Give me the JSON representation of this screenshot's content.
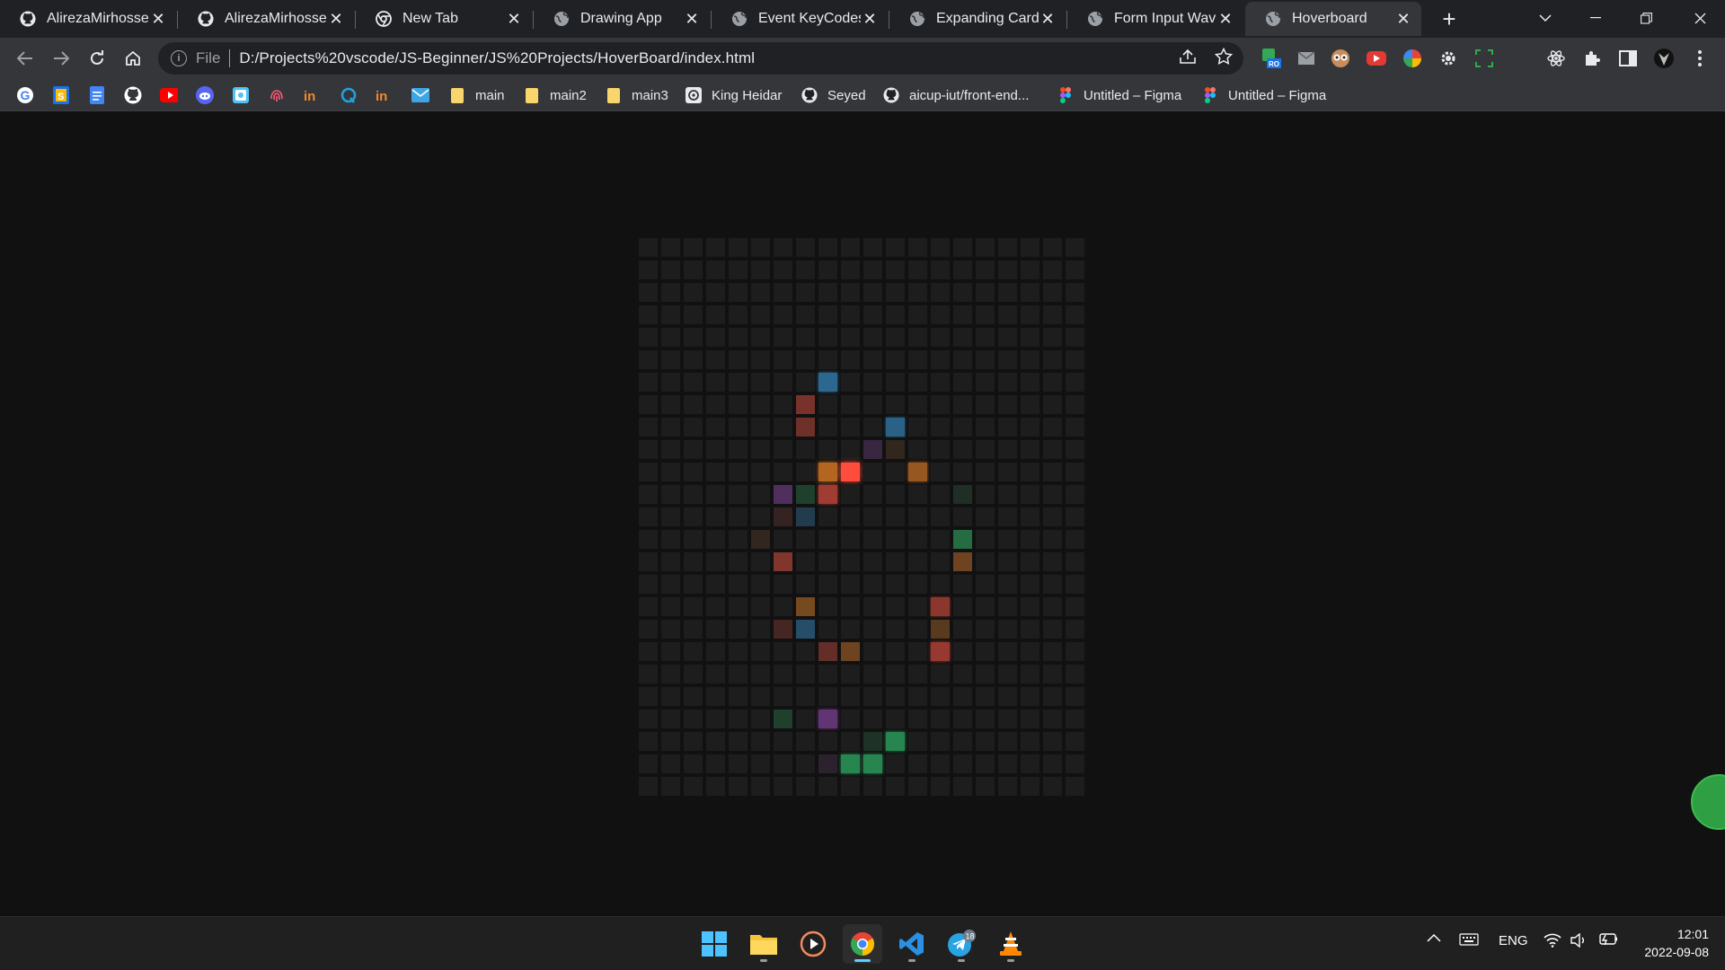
{
  "browser": {
    "tabs": [
      {
        "title": "AlirezaMirhossein",
        "icon": "github-icon",
        "active": false
      },
      {
        "title": "AlirezaMirhossein",
        "icon": "github-icon",
        "active": false
      },
      {
        "title": "New Tab",
        "icon": "chrome-icon",
        "active": false
      },
      {
        "title": "Drawing App",
        "icon": "globe-icon",
        "active": false
      },
      {
        "title": "Event KeyCodes",
        "icon": "globe-icon",
        "active": false
      },
      {
        "title": "Expanding Cards",
        "icon": "globe-icon",
        "active": false
      },
      {
        "title": "Form Input Wave",
        "icon": "globe-icon",
        "active": false
      },
      {
        "title": "Hoverboard",
        "icon": "globe-icon",
        "active": true
      }
    ],
    "new_tab_label": "+",
    "address_bar": {
      "scheme_label": "File",
      "url": "D:/Projects%20vscode/JS-Beginner/JS%20Projects/HoverBoard/index.html"
    },
    "bookmarks": [
      {
        "label": "main",
        "icon": "folder-icon"
      },
      {
        "label": "main2",
        "icon": "folder-icon"
      },
      {
        "label": "main3",
        "icon": "folder-icon"
      },
      {
        "label": "King Heidar",
        "icon": "openai-icon"
      },
      {
        "label": "Seyed",
        "icon": "github-icon"
      },
      {
        "label": "aicup-iut/front-end...",
        "icon": "github-icon"
      },
      {
        "label": "Untitled – Figma",
        "icon": "figma-icon"
      },
      {
        "label": "Untitled – Figma",
        "icon": "figma-icon"
      }
    ],
    "bookmark_icons": [
      "google-icon",
      "google-sheets-icon",
      "google-docs-icon",
      "github-icon",
      "youtube-icon",
      "discord-icon",
      "extension-icon",
      "fingerprint-icon",
      "invision-icon",
      "quora-icon",
      "invision-icon",
      "mail-icon"
    ]
  },
  "hoverboard": {
    "columns": 20,
    "rows": 25,
    "square_color": "#1d1d1d",
    "lit_squares": [
      {
        "row": 6,
        "col": 8,
        "color": "#3498db",
        "intensity": 0.6
      },
      {
        "row": 7,
        "col": 7,
        "color": "#e74c3c",
        "intensity": 0.45
      },
      {
        "row": 8,
        "col": 7,
        "color": "#e74c3c",
        "intensity": 0.4
      },
      {
        "row": 8,
        "col": 11,
        "color": "#3498db",
        "intensity": 0.55
      },
      {
        "row": 9,
        "col": 10,
        "color": "#8e44ad",
        "intensity": 0.25
      },
      {
        "row": 9,
        "col": 11,
        "color": "#e67e22",
        "intensity": 0.1
      },
      {
        "row": 10,
        "col": 8,
        "color": "#e67e22",
        "intensity": 0.75
      },
      {
        "row": 10,
        "col": 9,
        "color": "#ff4c3c",
        "intensity": 1.0
      },
      {
        "row": 10,
        "col": 12,
        "color": "#e67e22",
        "intensity": 0.6
      },
      {
        "row": 11,
        "col": 6,
        "color": "#8e44ad",
        "intensity": 0.45
      },
      {
        "row": 11,
        "col": 7,
        "color": "#2ecc71",
        "intensity": 0.2
      },
      {
        "row": 11,
        "col": 8,
        "color": "#e74c3c",
        "intensity": 0.65
      },
      {
        "row": 11,
        "col": 14,
        "color": "#2ecc71",
        "intensity": 0.1
      },
      {
        "row": 12,
        "col": 6,
        "color": "#e74c3c",
        "intensity": 0.12
      },
      {
        "row": 12,
        "col": 7,
        "color": "#3498db",
        "intensity": 0.25
      },
      {
        "row": 13,
        "col": 5,
        "color": "#e67e22",
        "intensity": 0.1
      },
      {
        "row": 13,
        "col": 14,
        "color": "#2ecc71",
        "intensity": 0.45
      },
      {
        "row": 14,
        "col": 6,
        "color": "#e74c3c",
        "intensity": 0.5
      },
      {
        "row": 14,
        "col": 14,
        "color": "#e67e22",
        "intensity": 0.4
      },
      {
        "row": 16,
        "col": 7,
        "color": "#e67e22",
        "intensity": 0.45
      },
      {
        "row": 16,
        "col": 13,
        "color": "#e74c3c",
        "intensity": 0.55
      },
      {
        "row": 17,
        "col": 6,
        "color": "#e74c3c",
        "intensity": 0.2
      },
      {
        "row": 17,
        "col": 7,
        "color": "#3498db",
        "intensity": 0.4
      },
      {
        "row": 17,
        "col": 13,
        "color": "#e67e22",
        "intensity": 0.3
      },
      {
        "row": 18,
        "col": 8,
        "color": "#e74c3c",
        "intensity": 0.35
      },
      {
        "row": 18,
        "col": 9,
        "color": "#e67e22",
        "intensity": 0.4
      },
      {
        "row": 18,
        "col": 13,
        "color": "#e74c3c",
        "intensity": 0.6
      },
      {
        "row": 21,
        "col": 6,
        "color": "#2ecc71",
        "intensity": 0.2
      },
      {
        "row": 21,
        "col": 8,
        "color": "#8e44ad",
        "intensity": 0.6
      },
      {
        "row": 22,
        "col": 10,
        "color": "#2ecc71",
        "intensity": 0.12
      },
      {
        "row": 22,
        "col": 11,
        "color": "#2ecc71",
        "intensity": 0.6
      },
      {
        "row": 23,
        "col": 8,
        "color": "#8e44ad",
        "intensity": 0.12
      },
      {
        "row": 23,
        "col": 9,
        "color": "#2ecc71",
        "intensity": 0.6
      },
      {
        "row": 23,
        "col": 10,
        "color": "#2ecc71",
        "intensity": 0.6
      }
    ]
  },
  "taskbar": {
    "apps": [
      {
        "name": "start-button",
        "icon": "windows-icon",
        "active": false,
        "running": false
      },
      {
        "name": "file-explorer",
        "icon": "folder-icon",
        "active": false,
        "running": true
      },
      {
        "name": "media-player",
        "icon": "play-icon",
        "active": false,
        "running": false
      },
      {
        "name": "chrome",
        "icon": "chrome-icon",
        "active": true,
        "running": true
      },
      {
        "name": "vscode",
        "icon": "vscode-icon",
        "active": false,
        "running": true
      },
      {
        "name": "telegram",
        "icon": "telegram-icon",
        "active": false,
        "running": true,
        "badge": "18"
      },
      {
        "name": "vlc",
        "icon": "vlc-icon",
        "active": false,
        "running": true
      }
    ],
    "language": "ENG",
    "time": "12:01",
    "date": "2022-09-08"
  }
}
